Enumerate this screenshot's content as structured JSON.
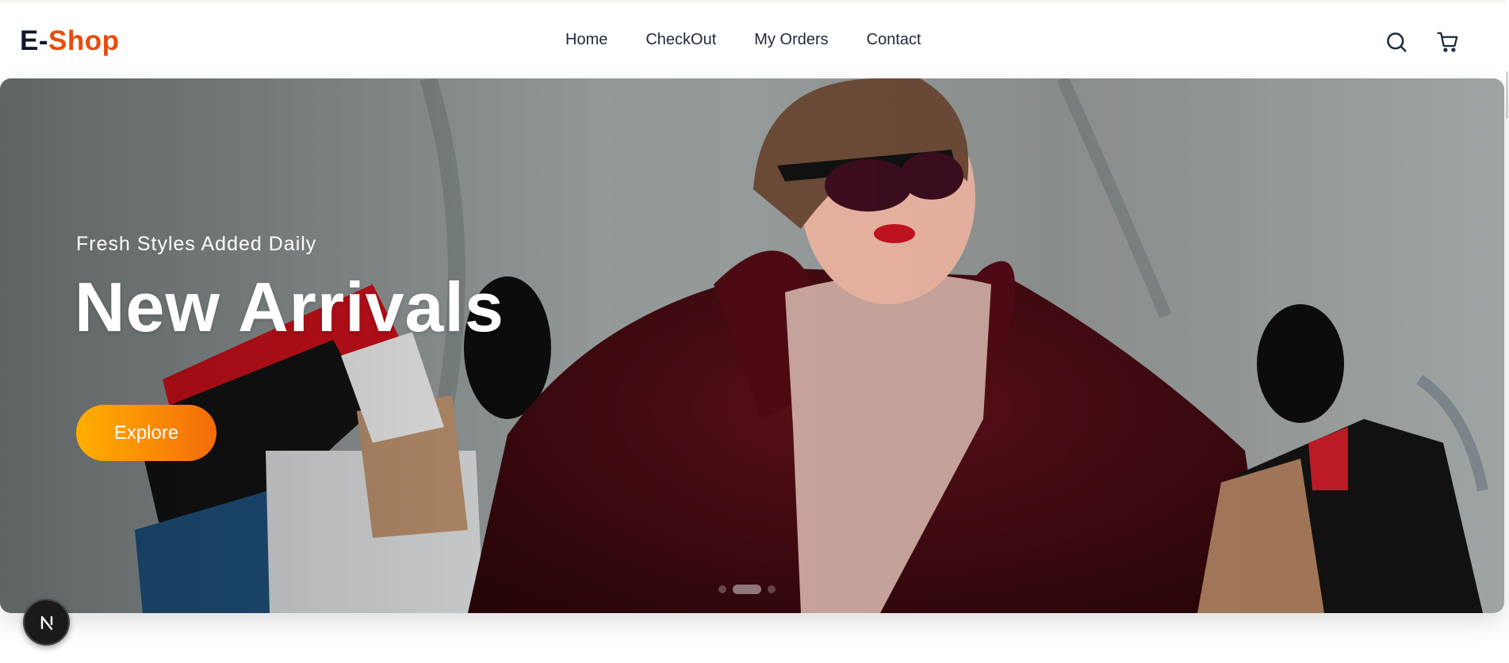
{
  "brand": {
    "part1": "E-",
    "part2": "Shop",
    "color_dark": "#0f172a",
    "color_accent": "#ea4b0c"
  },
  "nav": {
    "items": [
      {
        "label": "Home"
      },
      {
        "label": "CheckOut"
      },
      {
        "label": "My Orders"
      },
      {
        "label": "Contact"
      }
    ],
    "icons": [
      "search-icon",
      "cart-icon"
    ]
  },
  "hero": {
    "subtitle": "Fresh Styles Added Daily",
    "title": "New Arrivals",
    "cta_label": "Explore",
    "cta_gradient": [
      "#ffae00",
      "#f36c0a"
    ],
    "slides_count": 3,
    "active_slide": 2
  },
  "dev_badge": {
    "icon": "nextjs-icon",
    "letter": "N"
  }
}
